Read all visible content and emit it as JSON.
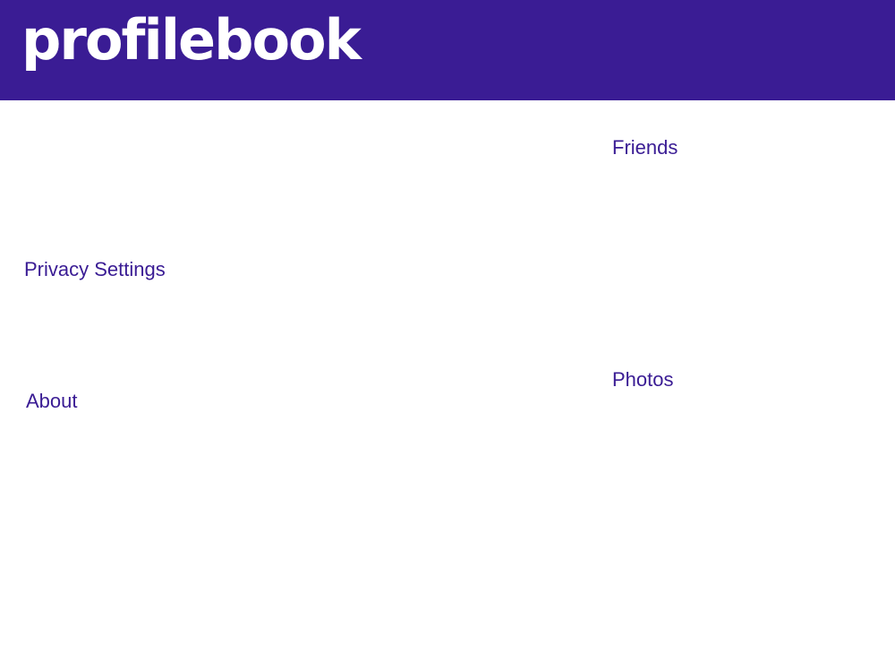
{
  "header": {
    "logo_text": "profilebook",
    "background_color": "#3a1c94",
    "logo_color": "#ffffff"
  },
  "sections": {
    "friends": "Friends",
    "privacy_settings": "Privacy Settings",
    "photos": "Photos",
    "about": "About"
  },
  "colors": {
    "accent": "#3a1c94",
    "background": "#ffffff"
  }
}
